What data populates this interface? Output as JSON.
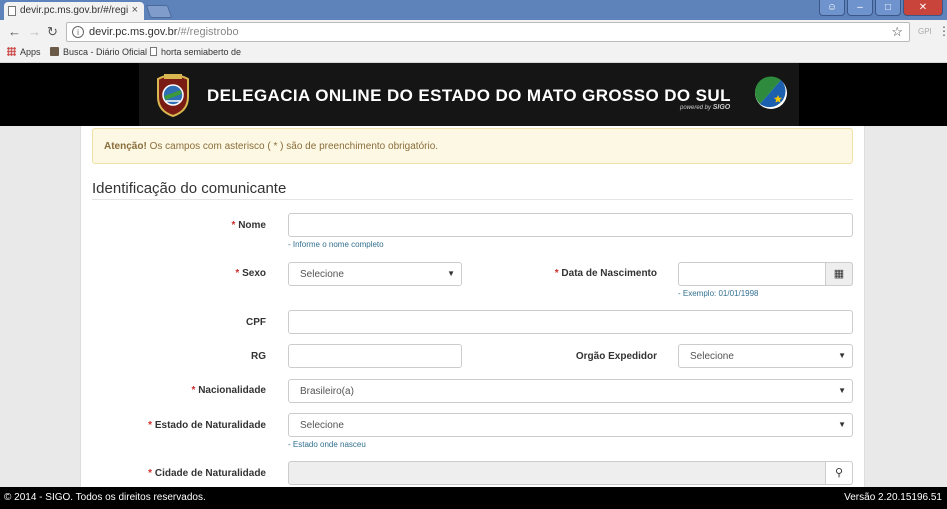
{
  "browser": {
    "tab_title": "devir.pc.ms.gov.br/#/regi",
    "tab_close": "×",
    "url_host": "devir.pc.ms.gov.br",
    "url_path": "/#/registrobo",
    "ext_label": "GPI",
    "bookmarks": [
      {
        "label": "Apps"
      },
      {
        "label": "Busca - Diário Oficial"
      },
      {
        "label": "horta semiaberto de"
      }
    ]
  },
  "banner": {
    "title": "DELEGACIA ONLINE DO ESTADO DO MATO GROSSO DO SUL",
    "powered_by": "powered by",
    "powered_brand": "SIGO"
  },
  "alert": {
    "strong": "Atenção!",
    "text": " Os campos com asterisco ( * ) são de preenchimento obrigatório."
  },
  "section": {
    "title": "Identificação do comunicante"
  },
  "form": {
    "required_mark": "*",
    "nome": {
      "label": "Nome",
      "value": "",
      "help": "- Informe o nome completo"
    },
    "sexo": {
      "label": "Sexo",
      "selected": "Selecione"
    },
    "data_nascimento": {
      "label": "Data de Nascimento",
      "value": "",
      "help": "- Exemplo: 01/01/1998"
    },
    "cpf": {
      "label": "CPF",
      "value": ""
    },
    "rg": {
      "label": "RG",
      "value": ""
    },
    "orgao_expedidor": {
      "label": "Orgão Expedidor",
      "selected": "Selecione"
    },
    "nacionalidade": {
      "label": "Nacionalidade",
      "selected": "Brasileiro(a)"
    },
    "estado_naturalidade": {
      "label": "Estado de Naturalidade",
      "selected": "Selecione",
      "help": "- Estado onde nasceu"
    },
    "cidade_naturalidade": {
      "label": "Cidade de Naturalidade",
      "value": ""
    }
  },
  "footer": {
    "copyright": "© 2014 - SIGO. Todos os direitos reservados.",
    "version": "Versão 2.20.15196.51"
  },
  "colors": {
    "banner_bg": "#000000",
    "alert_bg": "#fcf8e3",
    "alert_text": "#8a6d3b",
    "required": "#c9302c",
    "help_text": "#31708f"
  }
}
